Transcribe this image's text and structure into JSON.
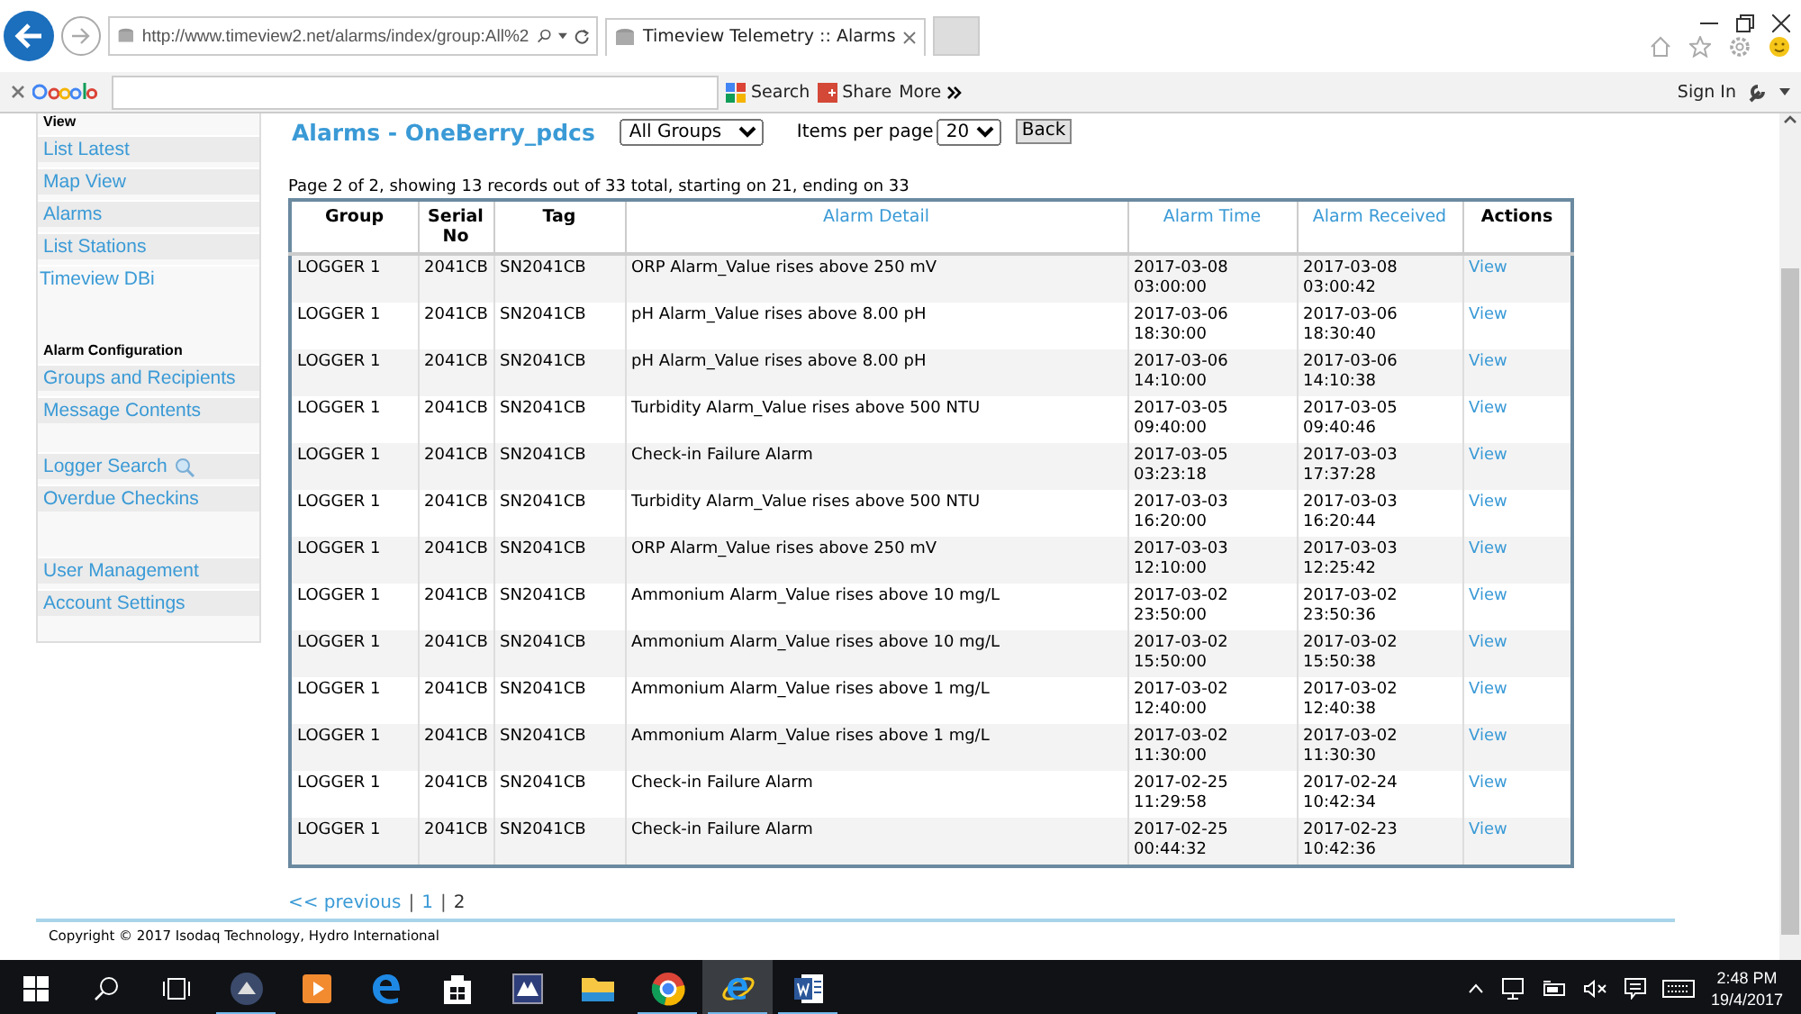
{
  "browser": {
    "address": "http://www.timeview2.net/alarms/index/group:All%2",
    "tab_title": "Timeview Telemetry :: Alarms",
    "toolbar": {
      "search_label": "Search",
      "share_label": "Share",
      "more_label": "More",
      "sign_in": "Sign In"
    }
  },
  "sidebar": {
    "sections": [
      {
        "heading": "View",
        "items": [
          {
            "label": "List Latest",
            "kind": "link"
          },
          {
            "label": "Map View",
            "kind": "link"
          },
          {
            "label": "Alarms",
            "kind": "link"
          },
          {
            "label": "List Stations",
            "kind": "link"
          }
        ]
      },
      {
        "items": [
          {
            "label": "Timeview DBi",
            "kind": "plain"
          }
        ]
      },
      {
        "heading": "Alarm Configuration",
        "items": [
          {
            "label": "Groups and Recipients",
            "kind": "link"
          },
          {
            "label": "Message Contents",
            "kind": "link"
          }
        ]
      },
      {
        "items": [
          {
            "label": "Logger Search",
            "kind": "search"
          },
          {
            "label": "Overdue Checkins",
            "kind": "link"
          }
        ]
      },
      {
        "items": [
          {
            "label": "User Management",
            "kind": "link"
          },
          {
            "label": "Account Settings",
            "kind": "link"
          }
        ]
      }
    ]
  },
  "page": {
    "title": "Alarms - OneBerry_pdcs",
    "group_select": "All Groups",
    "items_per_page_label": "Items per page",
    "items_per_page": "20",
    "back_button": "Back",
    "summary": "Page 2 of 2, showing 13 records out of 33 total, starting on 21, ending on 33"
  },
  "table": {
    "columns": [
      {
        "label": "Group",
        "sortable": false
      },
      {
        "label": "Serial No",
        "sortable": false
      },
      {
        "label": "Tag",
        "sortable": false
      },
      {
        "label": "Alarm Detail",
        "sortable": true
      },
      {
        "label": "Alarm Time",
        "sortable": true
      },
      {
        "label": "Alarm Received",
        "sortable": true
      },
      {
        "label": "Actions",
        "sortable": false
      }
    ],
    "rows": [
      [
        "LOGGER 1",
        "2041CB",
        "SN2041CB",
        "ORP Alarm_Value rises above 250 mV",
        "2017-03-08 03:00:00",
        "2017-03-08 03:00:42",
        "View"
      ],
      [
        "LOGGER 1",
        "2041CB",
        "SN2041CB",
        "pH Alarm_Value rises above 8.00 pH",
        "2017-03-06 18:30:00",
        "2017-03-06 18:30:40",
        "View"
      ],
      [
        "LOGGER 1",
        "2041CB",
        "SN2041CB",
        "pH Alarm_Value rises above 8.00 pH",
        "2017-03-06 14:10:00",
        "2017-03-06 14:10:38",
        "View"
      ],
      [
        "LOGGER 1",
        "2041CB",
        "SN2041CB",
        "Turbidity Alarm_Value rises above 500 NTU",
        "2017-03-05 09:40:00",
        "2017-03-05 09:40:46",
        "View"
      ],
      [
        "LOGGER 1",
        "2041CB",
        "SN2041CB",
        "Check-in Failure Alarm",
        "2017-03-05 03:23:18",
        "2017-03-03 17:37:28",
        "View"
      ],
      [
        "LOGGER 1",
        "2041CB",
        "SN2041CB",
        "Turbidity Alarm_Value rises above 500 NTU",
        "2017-03-03 16:20:00",
        "2017-03-03 16:20:44",
        "View"
      ],
      [
        "LOGGER 1",
        "2041CB",
        "SN2041CB",
        "ORP Alarm_Value rises above 250 mV",
        "2017-03-03 12:10:00",
        "2017-03-03 12:25:42",
        "View"
      ],
      [
        "LOGGER 1",
        "2041CB",
        "SN2041CB",
        "Ammonium Alarm_Value rises above 10 mg/L",
        "2017-03-02 23:50:00",
        "2017-03-02 23:50:36",
        "View"
      ],
      [
        "LOGGER 1",
        "2041CB",
        "SN2041CB",
        "Ammonium Alarm_Value rises above 10 mg/L",
        "2017-03-02 15:50:00",
        "2017-03-02 15:50:38",
        "View"
      ],
      [
        "LOGGER 1",
        "2041CB",
        "SN2041CB",
        "Ammonium Alarm_Value rises above 1 mg/L",
        "2017-03-02 12:40:00",
        "2017-03-02 12:40:38",
        "View"
      ],
      [
        "LOGGER 1",
        "2041CB",
        "SN2041CB",
        "Ammonium Alarm_Value rises above 1 mg/L",
        "2017-03-02 11:30:00",
        "2017-03-02 11:30:30",
        "View"
      ],
      [
        "LOGGER 1",
        "2041CB",
        "SN2041CB",
        "Check-in Failure Alarm",
        "2017-02-25 11:29:58",
        "2017-02-24 10:42:34",
        "View"
      ],
      [
        "LOGGER 1",
        "2041CB",
        "SN2041CB",
        "Check-in Failure Alarm",
        "2017-02-25 00:44:32",
        "2017-02-23 10:42:36",
        "View"
      ]
    ]
  },
  "pagination": [
    {
      "kind": "link",
      "text": "<< previous"
    },
    {
      "kind": "separator",
      "text": "|"
    },
    {
      "kind": "link",
      "text": "1"
    },
    {
      "kind": "separator",
      "text": "|"
    },
    {
      "kind": "current",
      "text": "2"
    }
  ],
  "footer": "Copyright © 2017 Isodaq Technology, Hydro International",
  "taskbar": {
    "apps": [
      {
        "kind": "circle-app",
        "running": true,
        "selected": false
      },
      {
        "kind": "video",
        "running": false,
        "selected": false
      },
      {
        "kind": "edge",
        "running": false,
        "selected": false
      },
      {
        "kind": "store",
        "running": false,
        "selected": false
      },
      {
        "kind": "mountain",
        "running": false,
        "selected": false
      },
      {
        "kind": "folder",
        "running": false,
        "selected": false
      },
      {
        "kind": "chrome",
        "running": true,
        "selected": false
      },
      {
        "kind": "ie",
        "running": true,
        "selected": true
      },
      {
        "kind": "word",
        "running": true,
        "selected": false
      }
    ],
    "time": "2:48 PM",
    "date": "19/4/2017"
  }
}
